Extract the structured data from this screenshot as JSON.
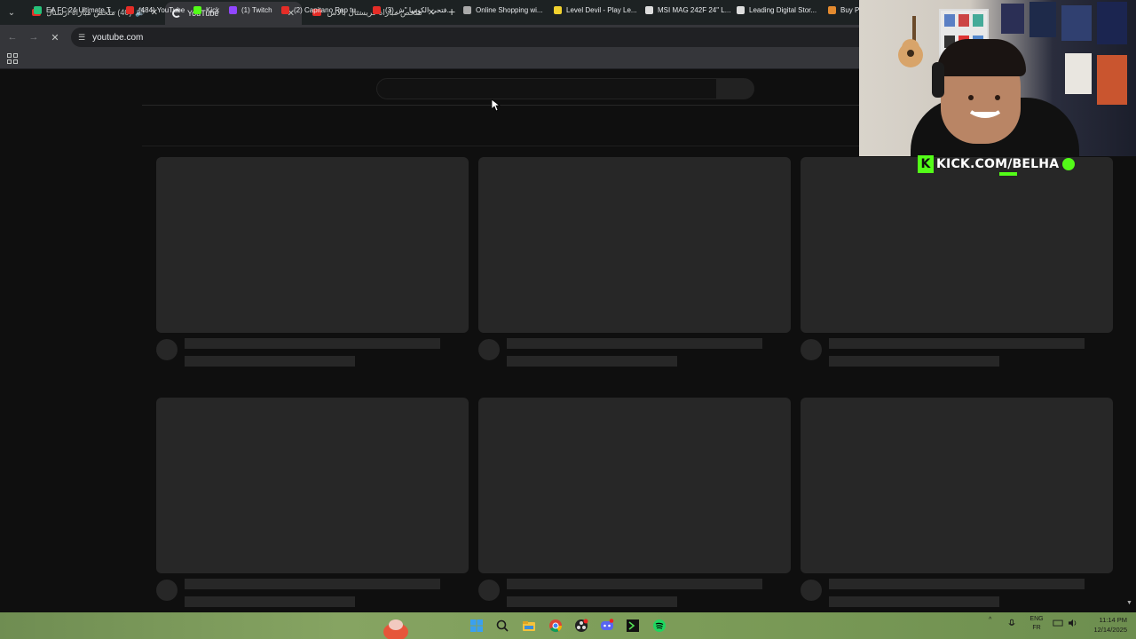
{
  "browser": {
    "tabs": [
      {
        "title": "(40) ملخص مباراة أرسنال وو",
        "favicon": "youtube-icon",
        "playing_audio": true,
        "active": false
      },
      {
        "title": "YouTube",
        "favicon": "loading-icon",
        "active": true
      },
      {
        "title": "ملخص مباراة كريستال بالاس وما",
        "favicon": "youtube-icon",
        "active": false
      }
    ],
    "new_tab_label": "+",
    "address": "youtube.com",
    "bookmarks": [
      {
        "label": "EA FC 24 Ultimate T...",
        "icon": "ea-icon",
        "color": "#27c17a"
      },
      {
        "label": "(484) YouTube",
        "icon": "youtube-icon",
        "color": "#e52d27"
      },
      {
        "label": "Kick",
        "icon": "kick-icon",
        "color": "#53fc18"
      },
      {
        "label": "(1) Twitch",
        "icon": "twitch-icon",
        "color": "#9146ff"
      },
      {
        "label": "(2) Capitano Rap tu...",
        "icon": "youtube-icon",
        "color": "#e52d27"
      },
      {
        "label": "(3) فتحي الكوميا \"ش...",
        "icon": "youtube-icon",
        "color": "#e52d27"
      },
      {
        "label": "Online Shopping wi...",
        "icon": "globe-icon",
        "color": "#aaaaaa"
      },
      {
        "label": "Level Devil - Play Le...",
        "icon": "level-devil-icon",
        "color": "#f2d22e"
      },
      {
        "label": "MSI MAG 242F 24\" L...",
        "icon": "msi-icon",
        "color": "#dddddd"
      },
      {
        "label": "Leading Digital Stor...",
        "icon": "store-icon",
        "color": "#dddddd"
      },
      {
        "label": "Buy P",
        "icon": "bag-icon",
        "color": "#e38a2f"
      }
    ]
  },
  "stream_overlay": {
    "kick_handle": "KICK.COM/BELHA",
    "kick_logo": "K"
  },
  "taskbar": {
    "language_top": "ENG",
    "language_bottom": "FR",
    "time": "11:14 PM",
    "date": "12/14/2025",
    "apps": [
      "windows-start-icon",
      "search-icon",
      "file-explorer-icon",
      "chrome-icon",
      "obs-icon",
      "discord-icon",
      "terminal-icon",
      "spotify-icon"
    ]
  },
  "colors": {
    "page_bg": "#0f0f0f",
    "skeleton": "#272727",
    "kick_green": "#53fc18"
  }
}
